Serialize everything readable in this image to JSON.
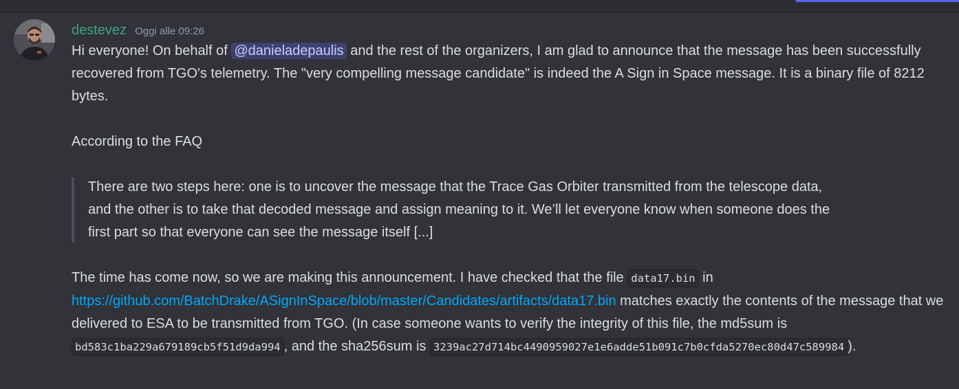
{
  "message": {
    "username": "destevez",
    "timestamp": "Oggi alle 09:26",
    "p1_before": "Hi everyone! On behalf of ",
    "mention": "@danieladepaulis",
    "p1_after": " and the rest of the organizers, I am glad to announce that the message has been successfully recovered from TGO's telemetry. The \"very compelling message candidate\" is indeed the A Sign in Space message. It is a binary file of 8212 bytes.",
    "p2": "According to the FAQ",
    "quote": "There are two steps here: one is to uncover the message that the Trace Gas Orbiter transmitted from the telescope data, and the other is to take that decoded message and assign meaning to it. We’ll let everyone know when someone does the first part so that everyone can see the message itself [...]",
    "p3_a": "The time has come now, so we are making this announcement. I have checked that the file ",
    "code_filename": "data17.bin",
    "p3_b": " in ",
    "link": "https://github.com/BatchDrake/ASignInSpace/blob/master/Candidates/artifacts/data17.bin",
    "p3_c": " matches exactly the contents of the message that we delivered to ESA to be transmitted from TGO. (In case someone wants to verify the integrity of this file, the md5sum is ",
    "code_md5": "bd583c1ba229a679189cb5f51d9da994",
    "p3_d": ", and the sha256sum is ",
    "code_sha256": "3239ac27d714bc4490959027e1e6adde51b091c7b0cfda5270ec80d47c589984",
    "p3_e": ")."
  },
  "colors": {
    "background": "#313338",
    "username": "#3ea57c",
    "link": "#00a8fc",
    "mention_bg": "#3c4270",
    "accent": "#5865f2"
  },
  "icons": {
    "avatar": "user-avatar"
  }
}
